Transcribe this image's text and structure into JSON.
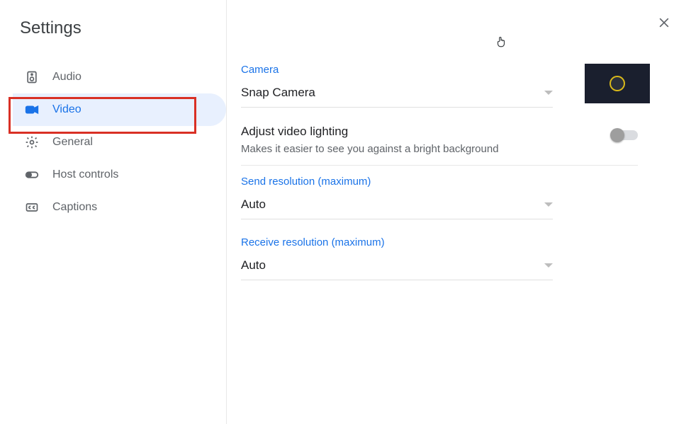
{
  "header": {
    "title": "Settings"
  },
  "sidebar": {
    "items": [
      {
        "id": "audio",
        "label": "Audio",
        "icon": "speaker-icon"
      },
      {
        "id": "video",
        "label": "Video",
        "icon": "videocam-icon",
        "active": true
      },
      {
        "id": "general",
        "label": "General",
        "icon": "gear-icon"
      },
      {
        "id": "host",
        "label": "Host controls",
        "icon": "toggle-icon"
      },
      {
        "id": "captions",
        "label": "Captions",
        "icon": "cc-icon"
      }
    ]
  },
  "main": {
    "camera": {
      "label": "Camera",
      "value": "Snap Camera"
    },
    "lighting": {
      "title": "Adjust video lighting",
      "desc": "Makes it easier to see you against a bright background",
      "enabled": false
    },
    "send_res": {
      "label": "Send resolution (maximum)",
      "value": "Auto"
    },
    "recv_res": {
      "label": "Receive resolution (maximum)",
      "value": "Auto"
    }
  }
}
